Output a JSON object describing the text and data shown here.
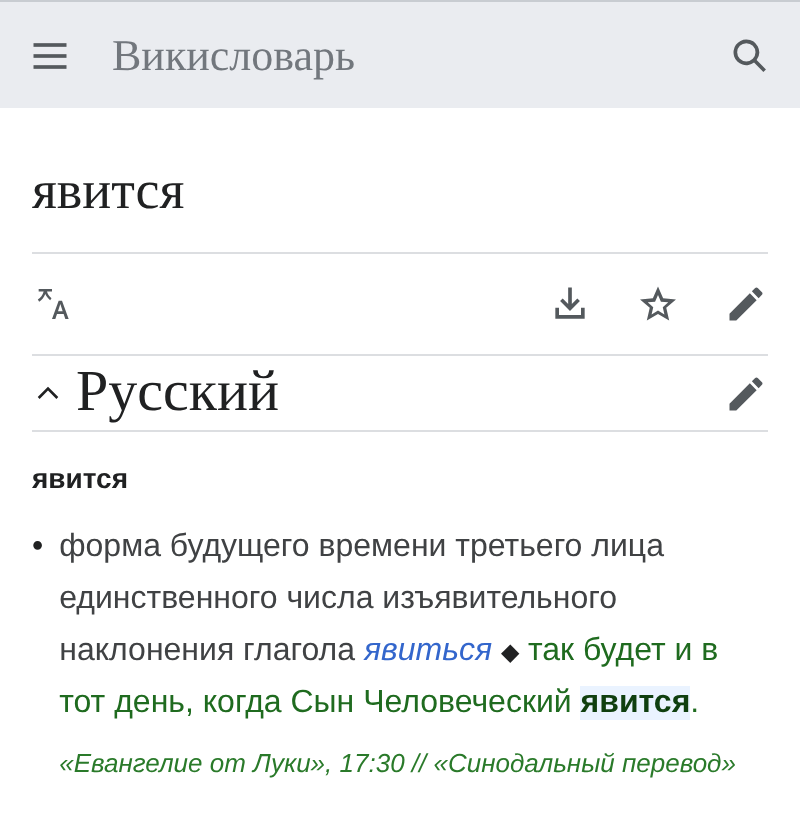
{
  "header": {
    "title": "Викисловарь"
  },
  "page_title": "явится",
  "section": {
    "title": "Русский",
    "expanded": true
  },
  "headword": "явится",
  "senses": [
    {
      "bullet": "•",
      "definition": "форма будущего времени третьего лица единственного числа изъявительного наклонения глагола",
      "link": "явиться",
      "separator": "◆",
      "example": "так будет и в тот день, когда Сын Человеческий **явится**.",
      "source": "«Евангелие от Луки», 17:30 // «Синодальный перевод»"
    }
  ]
}
